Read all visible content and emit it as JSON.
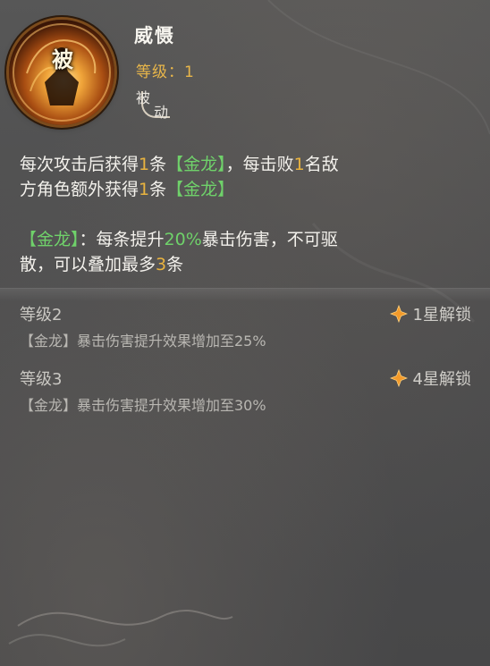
{
  "skill": {
    "icon": "golden-dragon-warrior-icon",
    "passive_tag": "被",
    "name": "威慑",
    "level_label": "等级：1",
    "type_badge": {
      "char1": "被",
      "char2": "动"
    }
  },
  "description": {
    "line1_parts": [
      "每次攻击后获得",
      "1",
      "条",
      "【金龙】",
      "，每击败",
      "1",
      "名敌"
    ],
    "line2_parts": [
      "方角色额外获得",
      "1",
      "条",
      "【金龙】"
    ],
    "effect_parts": [
      "【金龙】",
      "：每条提升",
      "20%",
      "暴击伤害，不可驱"
    ],
    "effect_line2_parts": [
      "散，可以叠加最多",
      "3",
      "条"
    ]
  },
  "upgrades": [
    {
      "level": "等级2",
      "unlock": "1星解锁",
      "effect": "【金龙】暴击伤害提升效果增加至25%"
    },
    {
      "level": "等级3",
      "unlock": "4星解锁",
      "effect": "【金龙】暴击伤害提升效果增加至30%"
    }
  ],
  "colors": {
    "gold": "#e9b33f",
    "green": "#6fd16a",
    "background": "#4b4b4c"
  }
}
